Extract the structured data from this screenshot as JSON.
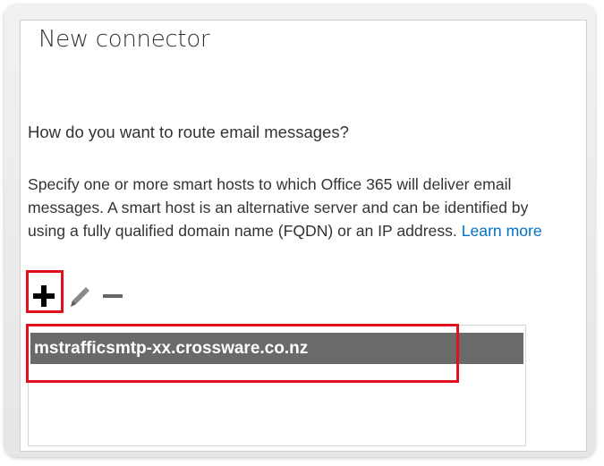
{
  "dialog": {
    "title": "New connector",
    "question": "How do you want to route email messages?",
    "description": "Specify one or more smart hosts to which Office 365 will deliver email messages. A smart host is an alternative server and can be identified by using a fully qualified domain name (FQDN) or an IP address.",
    "learn_more": "Learn more"
  },
  "toolbar": {
    "add_icon": "plus-icon",
    "edit_icon": "pencil-icon",
    "remove_icon": "minus-icon"
  },
  "smart_hosts": {
    "items": [
      {
        "host": "mstrafficsmtp-xx.crossware.co.nz",
        "selected": true
      }
    ]
  },
  "colors": {
    "highlight_border": "#e0101c",
    "selected_row": "#6a6a6a",
    "link": "#0072c6"
  }
}
